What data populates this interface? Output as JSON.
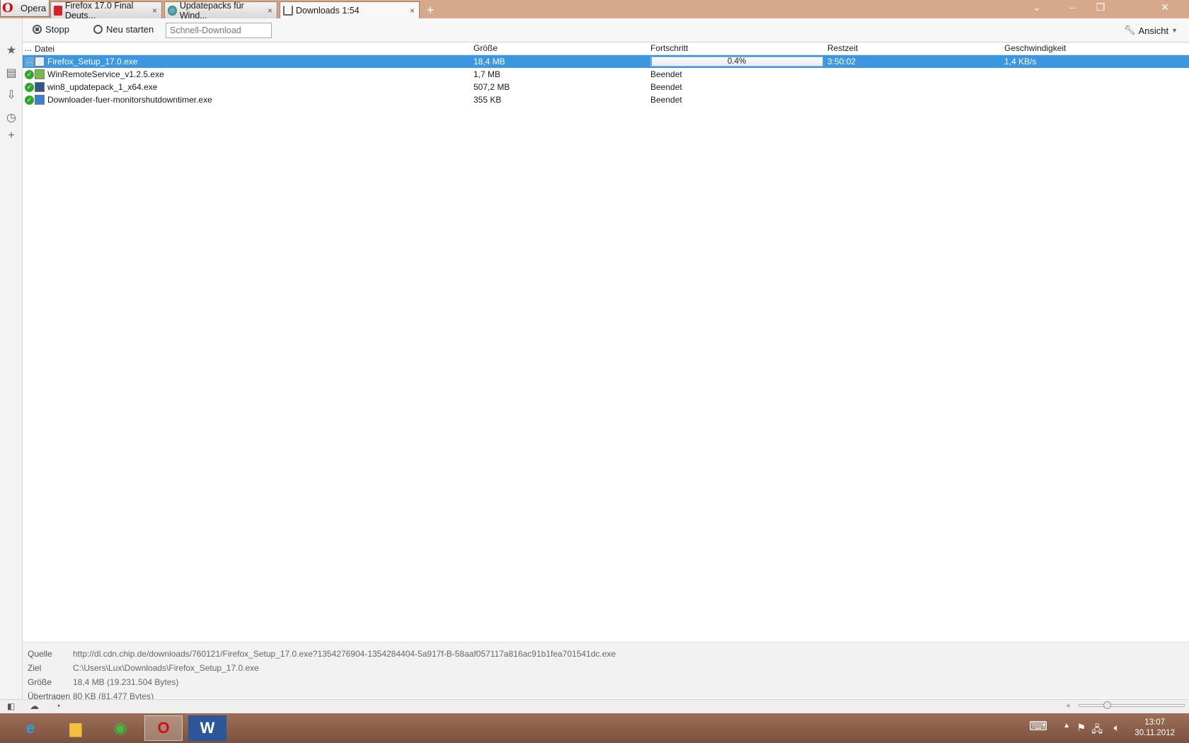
{
  "browser": {
    "menu_label": "Opera",
    "tabs": [
      {
        "title": "Firefox 17.0 Final Deuts...",
        "close": "×"
      },
      {
        "title": "Updatepacks für Wind...",
        "close": "×"
      },
      {
        "title": "Downloads 1:54",
        "close": "×"
      }
    ],
    "new_tab": "+"
  },
  "toolbar": {
    "stop_label": "Stopp",
    "restart_label": "Neu starten",
    "quick_download_placeholder": "Schnell-Download",
    "view_label": "Ansicht"
  },
  "table": {
    "headers": {
      "flag": "...",
      "file": "Datei",
      "size": "Größe",
      "progress": "Fortschritt",
      "remaining": "Restzeit",
      "speed": "Geschwindigkeit"
    },
    "rows": [
      {
        "file": "Firefox_Setup_17.0.exe",
        "size": "18,4 MB",
        "progress": "0.4%",
        "progress_value": 0.004,
        "remaining": "3:50:02",
        "speed": "1,4 KB/s",
        "status": "downloading"
      },
      {
        "file": "WinRemoteService_v1.2.5.exe",
        "size": "1,7 MB",
        "progress": "Beendet",
        "remaining": "",
        "speed": "",
        "status": "done"
      },
      {
        "file": "win8_updatepack_1_x64.exe",
        "size": "507,2 MB",
        "progress": "Beendet",
        "remaining": "",
        "speed": "",
        "status": "done"
      },
      {
        "file": "Downloader-fuer-monitorshutdowntimer.exe",
        "size": "355 KB",
        "progress": "Beendet",
        "remaining": "",
        "speed": "",
        "status": "done"
      }
    ]
  },
  "details": {
    "source_label": "Quelle",
    "source_value": "http://dl.cdn.chip.de/downloads/760121/Firefox_Setup_17.0.exe?1354276904-1354284404-5a917f-B-58aaf057117a816ac91b1fea701541dc.exe",
    "target_label": "Ziel",
    "target_value": "C:\\Users\\Lux\\Downloads\\Firefox_Setup_17.0.exe",
    "size_label": "Größe",
    "size_value": "18,4 MB (19.231.504 Bytes)",
    "transferred_label": "Übertragen",
    "transferred_value": "80 KB (81.477 Bytes)"
  },
  "taskbar": {
    "time": "13:07",
    "date": "30.11.2012"
  },
  "colors": {
    "titlebar": "#d6a98a",
    "selection": "#3c96e0",
    "success": "#2fa52f",
    "opera_red": "#cc0f16"
  }
}
